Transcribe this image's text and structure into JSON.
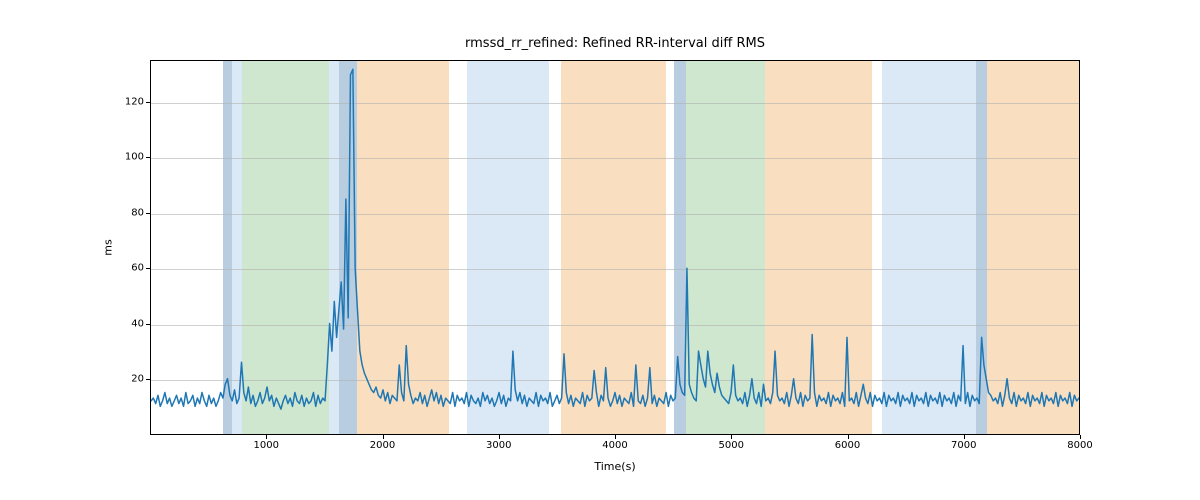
{
  "chart_data": {
    "type": "line",
    "title": "rmssd_rr_refined: Refined RR-interval diff RMS",
    "xlabel": "Time(s)",
    "ylabel": "ms",
    "xlim": [
      0,
      8000
    ],
    "ylim": [
      0,
      135
    ],
    "xticks": [
      1000,
      2000,
      3000,
      4000,
      5000,
      6000,
      7000,
      8000
    ],
    "yticks": [
      20,
      40,
      60,
      80,
      100,
      120
    ],
    "grid": "y",
    "bands": [
      {
        "x0": 620,
        "x1": 700,
        "color": "#b8cde0"
      },
      {
        "x0": 700,
        "x1": 780,
        "color": "#dbe9f6"
      },
      {
        "x0": 780,
        "x1": 1530,
        "color": "#cfe7cf"
      },
      {
        "x0": 1530,
        "x1": 1620,
        "color": "#dbe9f6"
      },
      {
        "x0": 1620,
        "x1": 1770,
        "color": "#b8cde0"
      },
      {
        "x0": 1770,
        "x1": 2560,
        "color": "#f9dfc0"
      },
      {
        "x0": 2720,
        "x1": 3420,
        "color": "#dbe9f6"
      },
      {
        "x0": 3530,
        "x1": 4430,
        "color": "#f9dfc0"
      },
      {
        "x0": 4500,
        "x1": 4600,
        "color": "#b8cde0"
      },
      {
        "x0": 4600,
        "x1": 5280,
        "color": "#cfe7cf"
      },
      {
        "x0": 5280,
        "x1": 6200,
        "color": "#f9dfc0"
      },
      {
        "x0": 6290,
        "x1": 7100,
        "color": "#dbe9f6"
      },
      {
        "x0": 7100,
        "x1": 7190,
        "color": "#b8cde0"
      },
      {
        "x0": 7190,
        "x1": 8000,
        "color": "#f9dfc0"
      }
    ],
    "series": [
      {
        "name": "rmssd_rr_refined",
        "color": "#1f77b4",
        "x": [
          0,
          20,
          40,
          60,
          80,
          100,
          120,
          140,
          160,
          180,
          200,
          220,
          240,
          260,
          280,
          300,
          320,
          340,
          360,
          380,
          400,
          420,
          440,
          460,
          480,
          500,
          520,
          540,
          560,
          580,
          600,
          620,
          640,
          660,
          680,
          700,
          720,
          740,
          760,
          780,
          800,
          820,
          840,
          860,
          880,
          900,
          920,
          940,
          960,
          980,
          1000,
          1020,
          1040,
          1060,
          1080,
          1100,
          1120,
          1140,
          1160,
          1180,
          1200,
          1220,
          1240,
          1260,
          1280,
          1300,
          1320,
          1340,
          1360,
          1380,
          1400,
          1420,
          1440,
          1460,
          1480,
          1500,
          1520,
          1540,
          1560,
          1580,
          1600,
          1620,
          1640,
          1660,
          1680,
          1700,
          1720,
          1740,
          1760,
          1780,
          1800,
          1820,
          1840,
          1860,
          1880,
          1900,
          1920,
          1940,
          1960,
          1980,
          2000,
          2020,
          2040,
          2060,
          2080,
          2100,
          2120,
          2140,
          2160,
          2180,
          2200,
          2220,
          2240,
          2260,
          2280,
          2300,
          2320,
          2340,
          2360,
          2380,
          2400,
          2420,
          2440,
          2460,
          2480,
          2500,
          2520,
          2540,
          2560,
          2580,
          2600,
          2620,
          2640,
          2660,
          2680,
          2700,
          2720,
          2740,
          2760,
          2780,
          2800,
          2820,
          2840,
          2860,
          2880,
          2900,
          2920,
          2940,
          2960,
          2980,
          3000,
          3020,
          3040,
          3060,
          3080,
          3100,
          3120,
          3140,
          3160,
          3180,
          3200,
          3220,
          3240,
          3260,
          3280,
          3300,
          3320,
          3340,
          3360,
          3380,
          3400,
          3420,
          3440,
          3460,
          3480,
          3500,
          3520,
          3540,
          3560,
          3580,
          3600,
          3620,
          3640,
          3660,
          3680,
          3700,
          3720,
          3740,
          3760,
          3780,
          3800,
          3820,
          3840,
          3860,
          3880,
          3900,
          3920,
          3940,
          3960,
          3980,
          4000,
          4020,
          4040,
          4060,
          4080,
          4100,
          4120,
          4140,
          4160,
          4180,
          4200,
          4220,
          4240,
          4260,
          4280,
          4300,
          4320,
          4340,
          4360,
          4380,
          4400,
          4420,
          4440,
          4460,
          4480,
          4500,
          4520,
          4540,
          4560,
          4580,
          4600,
          4620,
          4640,
          4660,
          4680,
          4700,
          4720,
          4740,
          4760,
          4780,
          4800,
          4820,
          4840,
          4860,
          4880,
          4900,
          4920,
          4940,
          4960,
          4980,
          5000,
          5020,
          5040,
          5060,
          5080,
          5100,
          5120,
          5140,
          5160,
          5180,
          5200,
          5220,
          5240,
          5260,
          5280,
          5300,
          5320,
          5340,
          5360,
          5380,
          5400,
          5420,
          5440,
          5460,
          5480,
          5500,
          5520,
          5540,
          5560,
          5580,
          5600,
          5620,
          5640,
          5660,
          5680,
          5700,
          5720,
          5740,
          5760,
          5780,
          5800,
          5820,
          5840,
          5860,
          5880,
          5900,
          5920,
          5940,
          5960,
          5980,
          6000,
          6020,
          6040,
          6060,
          6080,
          6100,
          6120,
          6140,
          6160,
          6180,
          6200,
          6220,
          6240,
          6260,
          6280,
          6300,
          6320,
          6340,
          6360,
          6380,
          6400,
          6420,
          6440,
          6460,
          6480,
          6500,
          6520,
          6540,
          6560,
          6580,
          6600,
          6620,
          6640,
          6660,
          6680,
          6700,
          6720,
          6740,
          6760,
          6780,
          6800,
          6820,
          6840,
          6860,
          6880,
          6900,
          6920,
          6940,
          6960,
          6980,
          7000,
          7020,
          7040,
          7060,
          7080,
          7100,
          7120,
          7140,
          7160,
          7180,
          7200,
          7220,
          7240,
          7260,
          7280,
          7300,
          7320,
          7340,
          7360,
          7380,
          7400,
          7420,
          7440,
          7460,
          7480,
          7500,
          7520,
          7540,
          7560,
          7580,
          7600,
          7620,
          7640,
          7660,
          7680,
          7700,
          7720,
          7740,
          7760,
          7780,
          7800,
          7820,
          7840,
          7860,
          7880,
          7900,
          7920,
          7940,
          7960,
          7980,
          8000
        ],
        "y": [
          12,
          13,
          11,
          14,
          10,
          12,
          15,
          11,
          13,
          10,
          12,
          14,
          11,
          13,
          10,
          15,
          11,
          12,
          14,
          10,
          13,
          11,
          15,
          12,
          10,
          14,
          11,
          13,
          10,
          12,
          15,
          13,
          18,
          20,
          14,
          12,
          16,
          11,
          13,
          26,
          15,
          12,
          17,
          11,
          14,
          10,
          12,
          15,
          11,
          13,
          17,
          12,
          14,
          10,
          13,
          11,
          9,
          12,
          14,
          11,
          13,
          10,
          15,
          12,
          11,
          14,
          10,
          13,
          11,
          12,
          15,
          10,
          14,
          11,
          13,
          12,
          25,
          40,
          30,
          48,
          35,
          45,
          55,
          38,
          85,
          42,
          130,
          132,
          60,
          45,
          30,
          25,
          22,
          20,
          18,
          16,
          15,
          17,
          14,
          13,
          16,
          12,
          15,
          11,
          14,
          13,
          12,
          25,
          15,
          12,
          32,
          18,
          14,
          11,
          13,
          12,
          15,
          11,
          14,
          10,
          13,
          16,
          12,
          15,
          11,
          14,
          10,
          13,
          12,
          11,
          15,
          10,
          14,
          12,
          13,
          11,
          15,
          10,
          14,
          12,
          11,
          13,
          10,
          15,
          12,
          14,
          11,
          13,
          10,
          12,
          15,
          11,
          14,
          10,
          13,
          12,
          30,
          16,
          12,
          15,
          11,
          14,
          10,
          13,
          12,
          11,
          15,
          10,
          14,
          12,
          13,
          11,
          15,
          10,
          12,
          14,
          11,
          13,
          29,
          15,
          11,
          14,
          10,
          13,
          12,
          11,
          15,
          10,
          14,
          12,
          13,
          23,
          15,
          10,
          14,
          12,
          24,
          13,
          10,
          12,
          15,
          11,
          14,
          10,
          13,
          12,
          11,
          15,
          10,
          25,
          12,
          11,
          14,
          10,
          13,
          24,
          11,
          14,
          10,
          13,
          12,
          11,
          15,
          10,
          14,
          12,
          13,
          28,
          18,
          15,
          14,
          60,
          18,
          15,
          13,
          12,
          30,
          25,
          20,
          17,
          30,
          22,
          18,
          15,
          22,
          17,
          14,
          13,
          12,
          11,
          15,
          25,
          14,
          12,
          13,
          11,
          15,
          10,
          14,
          20,
          13,
          11,
          15,
          10,
          18,
          12,
          13,
          11,
          15,
          30,
          14,
          12,
          13,
          11,
          15,
          10,
          14,
          20,
          13,
          11,
          15,
          10,
          14,
          12,
          13,
          36,
          15,
          10,
          14,
          12,
          13,
          11,
          15,
          10,
          14,
          12,
          13,
          11,
          15,
          10,
          35,
          12,
          13,
          11,
          15,
          10,
          14,
          18,
          13,
          11,
          15,
          10,
          14,
          12,
          13,
          11,
          15,
          10,
          14,
          12,
          13,
          11,
          15,
          10,
          14,
          12,
          13,
          11,
          15,
          10,
          14,
          12,
          13,
          11,
          15,
          10,
          14,
          12,
          13,
          11,
          15,
          10,
          14,
          12,
          13,
          11,
          15,
          10,
          14,
          12,
          32,
          11,
          15,
          10,
          14,
          12,
          13,
          11,
          35,
          25,
          20,
          15,
          14,
          12,
          13,
          11,
          15,
          10,
          14,
          20,
          13,
          11,
          15,
          10,
          14,
          12,
          13,
          11,
          15,
          10,
          14,
          12,
          13,
          11,
          15,
          10,
          14,
          12,
          13,
          11,
          15,
          10,
          14,
          12,
          13,
          11,
          15,
          10,
          14,
          12,
          13
        ]
      }
    ]
  }
}
